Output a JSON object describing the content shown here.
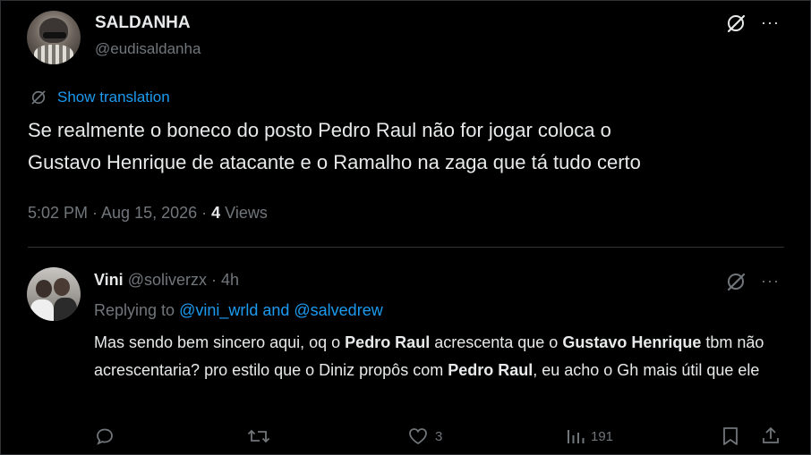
{
  "main_tweet": {
    "display_name": "SALDANHA",
    "handle": "@eudisaldanha",
    "show_translation": "Show translation",
    "text_line1": "Se realmente o boneco do posto Pedro Raul não for jogar coloca o",
    "text_line2": "Gustavo Henrique de atacante e o Ramalho na zaga que tá tudo certo",
    "timestamp": "5:02 PM · Aug 15, 2026 · ",
    "views_count": "4",
    "views_label": " Views"
  },
  "reply": {
    "display_name": "Vini",
    "handle": "@soliverzx",
    "time": " · 4h",
    "replying_to_label": "Replying to ",
    "replying_to_users": "@vini_wrld and @salvedrew",
    "body": [
      {
        "text": "Mas sendo bem sincero aqui, oq o ",
        "bold": false
      },
      {
        "text": "Pedro Raul",
        "bold": true
      },
      {
        "text": " acrescenta que o ",
        "bold": false
      },
      {
        "text": "Gustavo Henrique",
        "bold": true
      },
      {
        "text": " tbm não acrescentaria? pro estilo que o Diniz propôs com ",
        "bold": false
      },
      {
        "text": "Pedro Raul",
        "bold": true
      },
      {
        "text": ", eu acho o Gh mais útil que ele",
        "bold": false
      }
    ],
    "actions": {
      "reply_count": "",
      "retweet_count": "",
      "like_count": "3",
      "views_count": "191"
    }
  },
  "icons": {
    "grok": "grok-icon",
    "more": "more-icon",
    "translate": "translate-icon",
    "reply": "reply-icon",
    "retweet": "retweet-icon",
    "like": "heart-icon",
    "views": "views-icon",
    "bookmark": "bookmark-icon",
    "share": "share-icon"
  },
  "colors": {
    "background": "#000000",
    "text": "#e7e9ea",
    "muted": "#71767b",
    "link": "#1d9bf0",
    "divider": "#2f3336"
  },
  "more_glyph": "···"
}
